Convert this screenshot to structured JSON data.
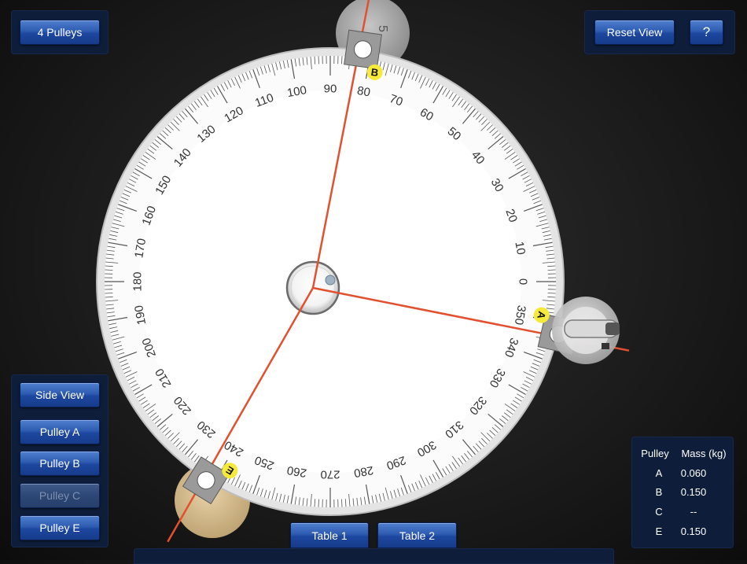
{
  "top_left": {
    "pulleys_button": "4 Pulleys"
  },
  "top_right": {
    "reset_view_button": "Reset View",
    "help_button": "?"
  },
  "left_panel": {
    "side_view_button": "Side View",
    "pulley_buttons": [
      {
        "label": "Pulley A",
        "enabled": true
      },
      {
        "label": "Pulley B",
        "enabled": true
      },
      {
        "label": "Pulley C",
        "enabled": false
      },
      {
        "label": "Pulley E",
        "enabled": true
      }
    ]
  },
  "tabs": {
    "table1": "Table 1",
    "table2": "Table 2"
  },
  "mass_table": {
    "headers": [
      "Pulley",
      "Mass (kg)"
    ],
    "rows": [
      {
        "pulley": "A",
        "mass": "0.060"
      },
      {
        "pulley": "B",
        "mass": "0.150"
      },
      {
        "pulley": "C",
        "mass": "--"
      },
      {
        "pulley": "E",
        "mass": "0.150"
      }
    ]
  },
  "force_table": {
    "angle_labels": [
      "0",
      "10",
      "20",
      "30",
      "40",
      "50",
      "60",
      "70",
      "80",
      "90",
      "100",
      "110",
      "120",
      "130",
      "140",
      "150",
      "160",
      "170",
      "180",
      "190",
      "200",
      "210",
      "220",
      "230",
      "240",
      "250",
      "260",
      "270",
      "280",
      "290",
      "300",
      "310",
      "320",
      "330",
      "340",
      "350"
    ],
    "pulleys": [
      {
        "label": "A",
        "angle_deg": 347
      },
      {
        "label": "B",
        "angle_deg": 82
      },
      {
        "label": "E",
        "angle_deg": 238
      }
    ],
    "colors": {
      "string": "#e2502f",
      "marker": "#f5ea3a",
      "button": "#2a5ab0",
      "panel": "#0e1d3a"
    }
  }
}
